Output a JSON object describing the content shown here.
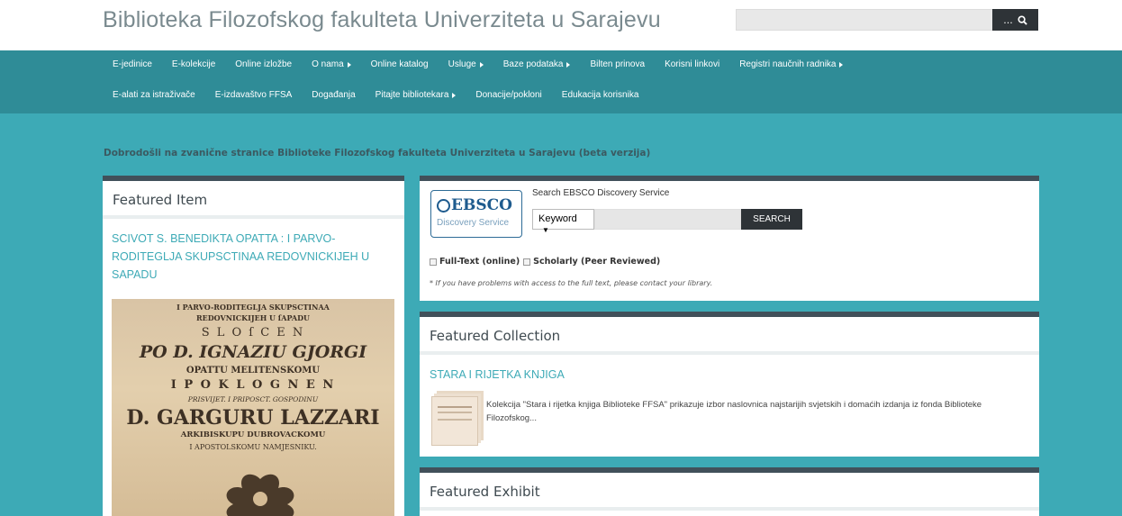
{
  "header": {
    "title": "Biblioteka Filozofskog fakulteta Univerziteta u Sarajevu",
    "search_button": "...",
    "search_icon": "search-icon"
  },
  "nav": {
    "row1": [
      "E-jedinice",
      "E-kolekcije",
      "Online izložbe",
      "O nama",
      "Online katalog",
      "Usluge",
      "Baze podataka",
      "Bilten prinova",
      "Korisni linkovi",
      "Registri naučnih radnika"
    ],
    "row1_dropdown": [
      false,
      false,
      false,
      true,
      false,
      true,
      true,
      false,
      false,
      true
    ],
    "row2": [
      "E-alati za istraživače",
      "E-izdavaštvo FFSA",
      "Događanja",
      "Pitajte bibliotekara",
      "Donacije/pokloni",
      "Edukacija korisnika"
    ],
    "row2_dropdown": [
      false,
      false,
      false,
      true,
      false,
      false
    ]
  },
  "welcome": "Dobrodošli na zvanične stranice Biblioteke Filozofskog fakulteta Univerziteta u Sarajevu (beta verzija)",
  "featured_item": {
    "heading": "Featured Item",
    "link": "SCIVOT S. BENEDIKTA OPATTA : I PARVO-RODITEGLJA SKUPSCTINAA REDOVNICKIJEH U SAPADU",
    "image_lines": [
      "I PARVO-RODITEGLJA SKUPSCTINAA",
      "REDOVNICKIJEH U ſAPADU",
      "S L O ſ C E N",
      "PO D. IGNAZIU GJORGI",
      "OPATTU MELITENSKOMU",
      "I P O K L O G N E N",
      "PRISVIJET. I PRIPOSCT. GOSPODINU",
      "D. GARGURU LAZZARI",
      "ARKIBISKUPU DUBROVACKOMU",
      "I APOSTOLSKOMU NAMJESNIKU."
    ]
  },
  "ebsco": {
    "logo_name": "EBSCO",
    "logo_sub": "Discovery Service",
    "label": "Search EBSCO Discovery Service",
    "select_value": "Keyword",
    "search_button": "SEARCH",
    "check_fulltext": "Full-Text (online)",
    "check_scholarly": "Scholarly (Peer Reviewed)",
    "note": "* If you have problems with access to the full text, please contact your library."
  },
  "featured_collection": {
    "heading": "Featured Collection",
    "link": "STARA I RIJETKA KNJIGA",
    "description": "Kolekcija \"Stara i rijetka knjiga Biblioteke FFSA\" prikazuje izbor naslovnica najstarijih svjetskih i domaćih izdanja iz fonda Biblioteke Filozofskog..."
  },
  "featured_exhibit": {
    "heading": "Featured Exhibit"
  },
  "colors": {
    "nav": "#2f8c97",
    "band": "#3daab6",
    "panel_top": "#41505a",
    "link": "#3daab6"
  }
}
